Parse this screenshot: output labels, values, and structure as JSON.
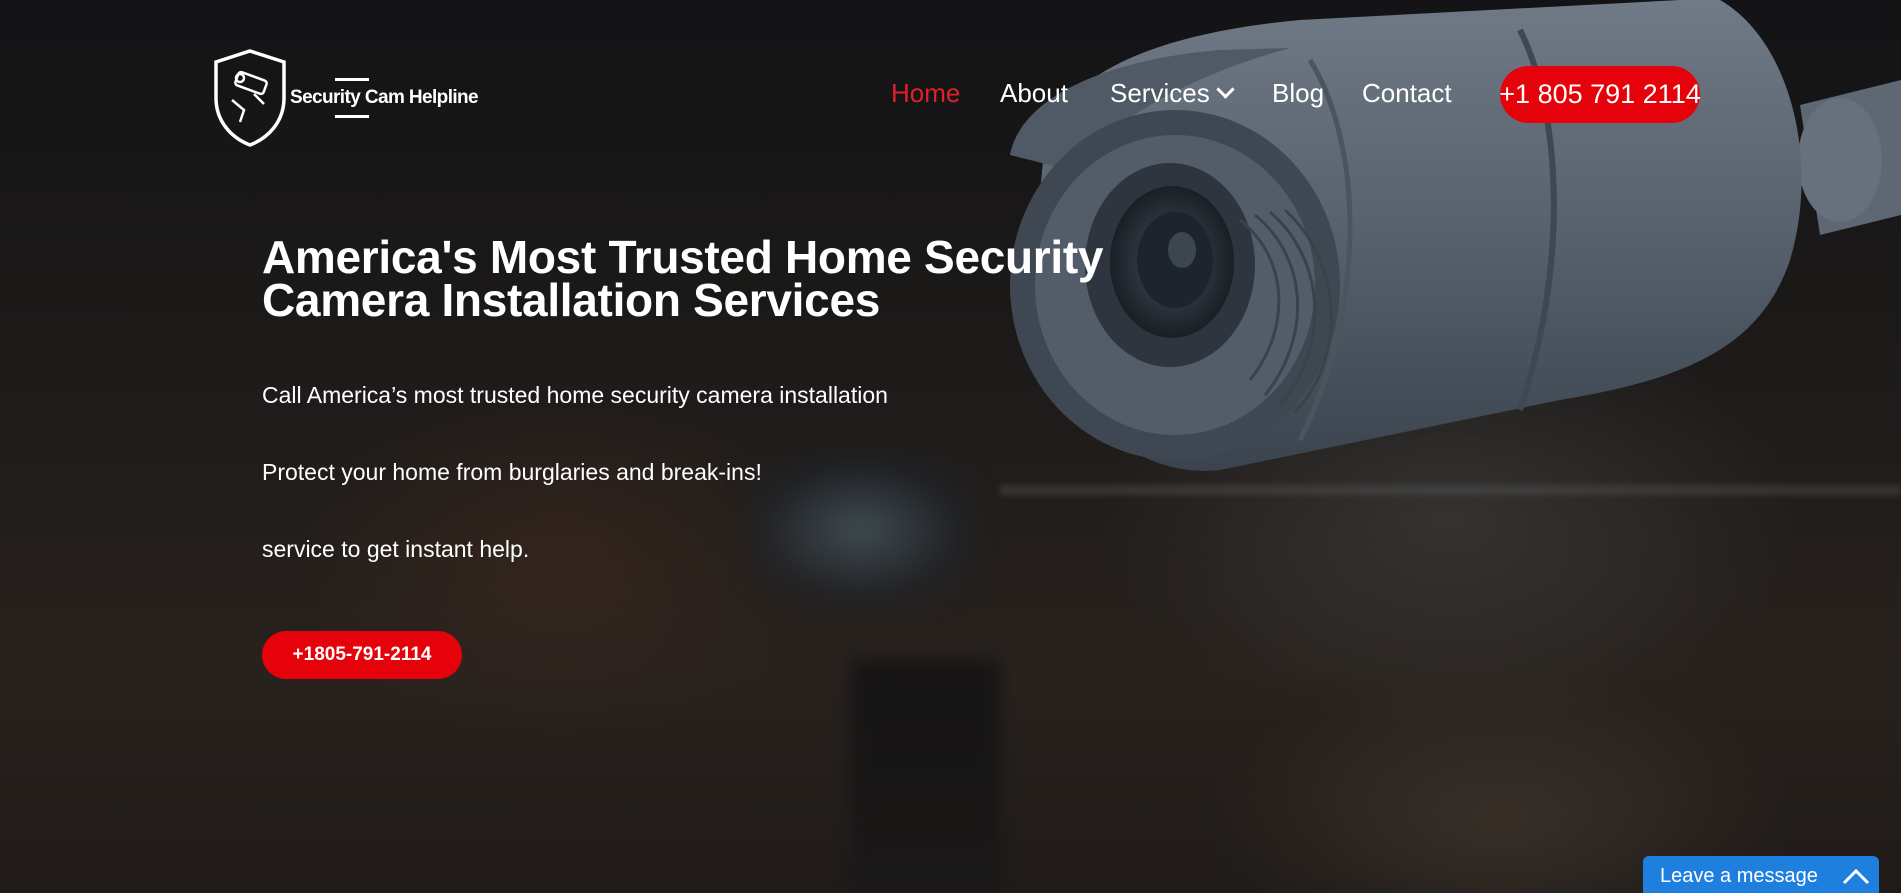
{
  "brand": {
    "name": "Security Cam Helpline",
    "accent": "#e5020a",
    "active_nav_color": "#e0202d",
    "chat_color": "#1f7fde"
  },
  "nav": {
    "items": [
      {
        "label": "Home",
        "active": true
      },
      {
        "label": "About",
        "active": false
      },
      {
        "label": "Services",
        "active": false,
        "has_dropdown": true,
        "icon": "chevron-down-icon"
      },
      {
        "label": "Blog",
        "active": false
      },
      {
        "label": "Contact",
        "active": false
      }
    ],
    "phone_button": "+1 805 791 2114"
  },
  "hero": {
    "headline_line1": "America's Most Trusted Home Security",
    "headline_line2": "Camera Installation Services",
    "paragraphs": [
      "Call America’s most trusted home security camera installation",
      "Protect your home from burglaries and break-ins!",
      "service to get instant help."
    ],
    "cta_label": "+1805-791-2114"
  },
  "chat": {
    "label": "Leave a message",
    "icon": "chevron-up-icon"
  }
}
